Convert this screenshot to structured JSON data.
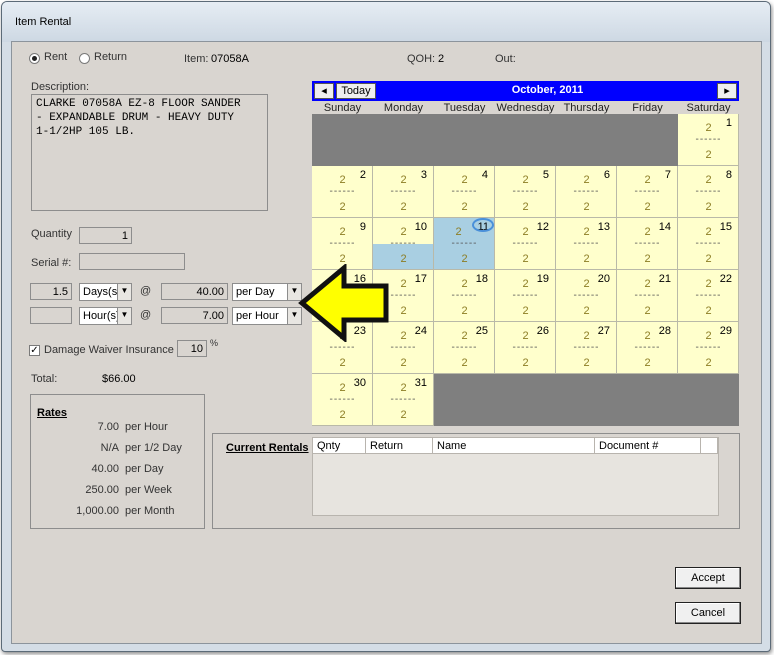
{
  "window": {
    "title": "Item Rental"
  },
  "mode": {
    "rent_label": "Rent",
    "return_label": "Return",
    "selected": "Rent"
  },
  "item": {
    "label": "Item:",
    "value": "07058A"
  },
  "qoh": {
    "label": "QOH:",
    "value": "2"
  },
  "out": {
    "label": "Out:"
  },
  "description": {
    "label": "Description:",
    "text": "CLARKE 07058A EZ-8 FLOOR SANDER\n- EXPANDABLE DRUM - HEAVY DUTY\n1-1/2HP 105 LB."
  },
  "quantity": {
    "label": "Quantity",
    "value": "1"
  },
  "serial": {
    "label": "Serial #:",
    "value": ""
  },
  "duration": [
    {
      "qty": "1.5",
      "unit": "Days(s)",
      "at": "@",
      "rate": "40.00",
      "per": "per Day"
    },
    {
      "qty": "",
      "unit": "Hour(s)",
      "at": "@",
      "rate": "7.00",
      "per": "per Hour"
    }
  ],
  "damage_waiver": {
    "label": "Damage Waiver Insurance @",
    "value": "10",
    "unit": "%",
    "checked": true,
    "check_glyph": "✓"
  },
  "total": {
    "label": "Total:",
    "value": "$66.00"
  },
  "rates": {
    "title": "Rates",
    "rows": [
      {
        "value": "7.00",
        "unit": "per Hour"
      },
      {
        "value": "N/A",
        "unit": "per 1/2 Day"
      },
      {
        "value": "40.00",
        "unit": "per Day"
      },
      {
        "value": "250.00",
        "unit": "per Week"
      },
      {
        "value": "1,000.00",
        "unit": "per Month"
      }
    ]
  },
  "calendar": {
    "prev_label": "◂",
    "next_label": "▸",
    "today_label": "Today",
    "month_title": "October, 2011",
    "weekdays": [
      "Sunday",
      "Monday",
      "Tuesday",
      "Wednesday",
      "Thursday",
      "Friday",
      "Saturday"
    ],
    "days": [
      {
        "day": "1",
        "top": "2",
        "dash": "------",
        "bottom": "2"
      },
      {
        "day": "2",
        "top": "2",
        "dash": "------",
        "bottom": "2"
      },
      {
        "day": "3",
        "top": "2",
        "dash": "------",
        "bottom": "2"
      },
      {
        "day": "4",
        "top": "2",
        "dash": "------",
        "bottom": "2"
      },
      {
        "day": "5",
        "top": "2",
        "dash": "------",
        "bottom": "2"
      },
      {
        "day": "6",
        "top": "2",
        "dash": "------",
        "bottom": "2"
      },
      {
        "day": "7",
        "top": "2",
        "dash": "------",
        "bottom": "2"
      },
      {
        "day": "8",
        "top": "2",
        "dash": "------",
        "bottom": "2"
      },
      {
        "day": "9",
        "top": "2",
        "dash": "------",
        "bottom": "2"
      },
      {
        "day": "10",
        "top": "2",
        "dash": "------",
        "bottom": "2"
      },
      {
        "day": "11",
        "top": "2",
        "dash": "------",
        "bottom": "2"
      },
      {
        "day": "12",
        "top": "2",
        "dash": "------",
        "bottom": "2"
      },
      {
        "day": "13",
        "top": "2",
        "dash": "------",
        "bottom": "2"
      },
      {
        "day": "14",
        "top": "2",
        "dash": "------",
        "bottom": "2"
      },
      {
        "day": "15",
        "top": "2",
        "dash": "------",
        "bottom": "2"
      },
      {
        "day": "16",
        "top": "2",
        "dash": "------",
        "bottom": "2"
      },
      {
        "day": "17",
        "top": "2",
        "dash": "------",
        "bottom": "2"
      },
      {
        "day": "18",
        "top": "2",
        "dash": "------",
        "bottom": "2"
      },
      {
        "day": "19",
        "top": "2",
        "dash": "------",
        "bottom": "2"
      },
      {
        "day": "20",
        "top": "2",
        "dash": "------",
        "bottom": "2"
      },
      {
        "day": "21",
        "top": "2",
        "dash": "------",
        "bottom": "2"
      },
      {
        "day": "22",
        "top": "2",
        "dash": "------",
        "bottom": "2"
      },
      {
        "day": "23",
        "top": "2",
        "dash": "------",
        "bottom": "2"
      },
      {
        "day": "24",
        "top": "2",
        "dash": "------",
        "bottom": "2"
      },
      {
        "day": "25",
        "top": "2",
        "dash": "------",
        "bottom": "2"
      },
      {
        "day": "26",
        "top": "2",
        "dash": "------",
        "bottom": "2"
      },
      {
        "day": "27",
        "top": "2",
        "dash": "------",
        "bottom": "2"
      },
      {
        "day": "28",
        "top": "2",
        "dash": "------",
        "bottom": "2"
      },
      {
        "day": "29",
        "top": "2",
        "dash": "------",
        "bottom": "2"
      },
      {
        "day": "30",
        "top": "2",
        "dash": "------",
        "bottom": "2"
      },
      {
        "day": "31",
        "top": "2",
        "dash": "------",
        "bottom": "2"
      }
    ],
    "today": "11",
    "highlight_color": "#a9cfe2",
    "cell_color": "#ffffcc"
  },
  "current_rentals": {
    "title": "Current Rentals",
    "columns": [
      "Qnty",
      "Return",
      "Name",
      "Document #"
    ],
    "rows": []
  },
  "buttons": {
    "accept": "Accept",
    "cancel": "Cancel"
  },
  "annotation": {
    "arrow_color": "#ffff00",
    "arrow_icon": "arrow-left-icon"
  }
}
